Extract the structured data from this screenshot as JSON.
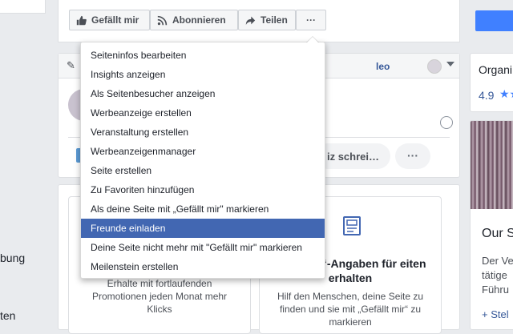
{
  "sidebar": {
    "items": [
      "bung",
      "ten"
    ]
  },
  "toolbar": {
    "like_label": "Gefällt mir",
    "subscribe_label": "Abonnieren",
    "share_label": "Teilen",
    "more_label": "···"
  },
  "composer": {
    "video_label": "leo",
    "post_pill_label": "iz schrei…",
    "more_label": "···"
  },
  "menu": {
    "items": [
      "Seiteninfos bearbeiten",
      "Insights anzeigen",
      "Als Seitenbesucher anzeigen",
      "Werbeanzeige erstellen",
      "Veranstaltung erstellen",
      "Werbeanzeigenmanager",
      "Seite erstellen",
      "Zu Favoriten hinzufügen",
      "Als deine Seite mit „Gefällt mir\" markieren",
      "Freunde einladen",
      "Deine Seite nicht mehr mit \"Gefällt mir\" markieren",
      "Meilenstein erstellen"
    ],
    "active_index": 9
  },
  "promo": {
    "card1": {
      "desc": "Erhalte mit fortlaufenden Promotionen jeden Monat mehr Klicks"
    },
    "card2": {
      "title": "efällt mir“-Angaben für eiten erhalten",
      "desc": "Hilf den Menschen, deine Seite zu finden und sie mit „Gefällt mir“ zu markieren"
    }
  },
  "right_column": {
    "org_title": "Organi",
    "rating": "4.9",
    "stars": "★★",
    "heading": "Our S",
    "para_lines": [
      "Der Ve",
      "tätige",
      "Führu"
    ],
    "link": "+ Stel"
  },
  "colors": {
    "accent": "#4267b2",
    "link": "#365899",
    "primary": "#4080ff"
  }
}
